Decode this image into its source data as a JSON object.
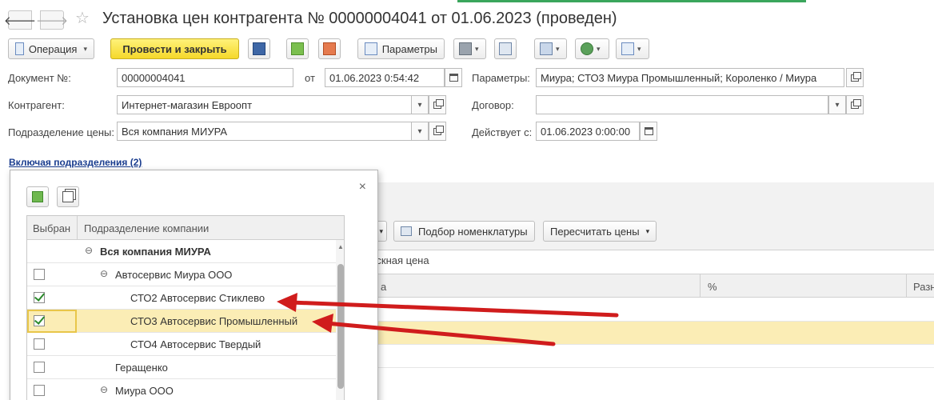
{
  "window": {
    "back_glyph": "🡐",
    "forward_glyph": "🡒",
    "star_glyph": "☆",
    "title": "Установка цен контрагента № 00000004041 от 01.06.2023 (проведен)"
  },
  "toolbar": {
    "operation_label": "Операция",
    "post_close_label": "Провести и закрыть",
    "parameters_label": "Параметры",
    "dropdown_glyph": "▾"
  },
  "form": {
    "doc_number_label": "Документ №:",
    "doc_number_value": "00000004041",
    "from_label": "от",
    "date_value": "01.06.2023  0:54:42",
    "params_label": "Параметры:",
    "params_value": "Миура; СТО3 Миура Промышленный; Короленко / Миура",
    "counterparty_label": "Контрагент:",
    "counterparty_value": "Интернет-магазин Евроопт",
    "contract_label": "Договор:",
    "contract_value": "",
    "price_division_label": "Подразделение цены:",
    "price_division_value": "Вся компания МИУРА",
    "valid_from_label": "Действует с:",
    "valid_from_value": "01.06.2023  0:00:00",
    "including_divisions_link": "Включая подразделения (2)"
  },
  "background_table": {
    "pick_button": "Подбор номенклатуры",
    "recalc_button": "Пересчитать цены",
    "caption": "пускная цена",
    "col_a": "а",
    "col_percent": "%",
    "col_diff": "Разн"
  },
  "popup": {
    "close_glyph": "×",
    "header_selected": "Выбран",
    "header_division": "Подразделение компании",
    "collapse_glyph": "⊖",
    "scroll_up": "▲",
    "scroll_down": "▼",
    "rows": [
      {
        "label": "Вся компания МИУРА",
        "checked": false,
        "has_checkbox": false,
        "bold": true,
        "level": 0,
        "toggle": true
      },
      {
        "label": "Автосервис Миура ООО",
        "checked": false,
        "has_checkbox": true,
        "bold": false,
        "level": 1,
        "toggle": true
      },
      {
        "label": "СТО2 Автосервис Стиклево",
        "checked": true,
        "has_checkbox": true,
        "bold": false,
        "level": 2,
        "toggle": false
      },
      {
        "label": "СТО3 Автосервис Промышленный",
        "checked": true,
        "has_checkbox": true,
        "bold": false,
        "level": 2,
        "toggle": false,
        "selected": true
      },
      {
        "label": "СТО4 Автосервис Твердый",
        "checked": false,
        "has_checkbox": true,
        "bold": false,
        "level": 2,
        "toggle": false
      },
      {
        "label": "Геращенко",
        "checked": false,
        "has_checkbox": true,
        "bold": false,
        "level": 1,
        "toggle": false
      },
      {
        "label": "Миура ООО",
        "checked": false,
        "has_checkbox": true,
        "bold": false,
        "level": 1,
        "toggle": true
      }
    ]
  },
  "colors": {
    "primary_button": "#f5d82a",
    "selection_row": "#fbedb5",
    "annotation_arrow": "#d01c1c",
    "link": "#1a3d8f",
    "check": "#2b8a2b"
  }
}
